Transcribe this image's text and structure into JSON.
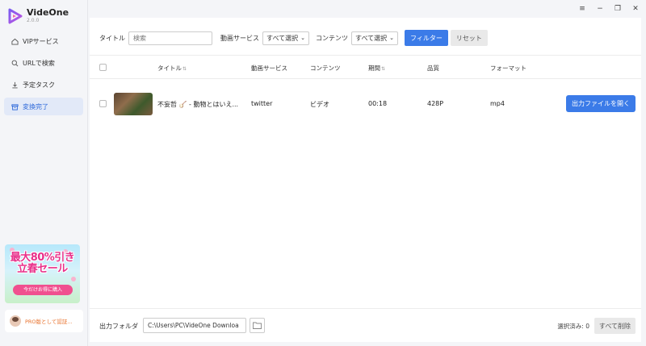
{
  "app": {
    "name": "VideOne",
    "version": "2.0.0",
    "accent": "#3b7be8"
  },
  "nav": [
    {
      "label": "VIPサービス",
      "icon": "home-icon",
      "active": false
    },
    {
      "label": "URLで検索",
      "icon": "search-icon",
      "active": false
    },
    {
      "label": "予定タスク",
      "icon": "download-icon",
      "active": false
    },
    {
      "label": "変換完了",
      "icon": "archive-icon",
      "active": true
    }
  ],
  "promo": {
    "title_line1": "最大80%引き",
    "title_line2": "立春セール",
    "button": "今だけお得に購入"
  },
  "user": {
    "text": "PRO版として認証..."
  },
  "window_controls": {
    "menu": "≡",
    "minimize": "−",
    "restore": "❐",
    "close": "✕"
  },
  "filter": {
    "title_label": "タイトル",
    "search_placeholder": "検索",
    "service_label": "動画サービス",
    "service_value": "すべて選択",
    "content_label": "コンテンツ",
    "content_value": "すべて選択",
    "filter_button": "フィルター",
    "reset_button": "リセット"
  },
  "table": {
    "headers": {
      "title": "タイトル",
      "service": "動画サービス",
      "content": "コンテンツ",
      "duration": "期間",
      "quality": "品質",
      "format": "フォーマット"
    },
    "rows": [
      {
        "title": "不妄哲 🪕 - 動物とはいえ...",
        "service": "twitter",
        "content": "ビデオ",
        "duration": "00:18",
        "quality": "428P",
        "format": "mp4",
        "action": "出力ファイルを開く"
      }
    ]
  },
  "footer": {
    "output_label": "出力フォルダ",
    "output_path": "C:\\Users\\PC\\VideOne Downloa",
    "selected_label": "選択済み: 0",
    "delete_all": "すべて削除"
  }
}
